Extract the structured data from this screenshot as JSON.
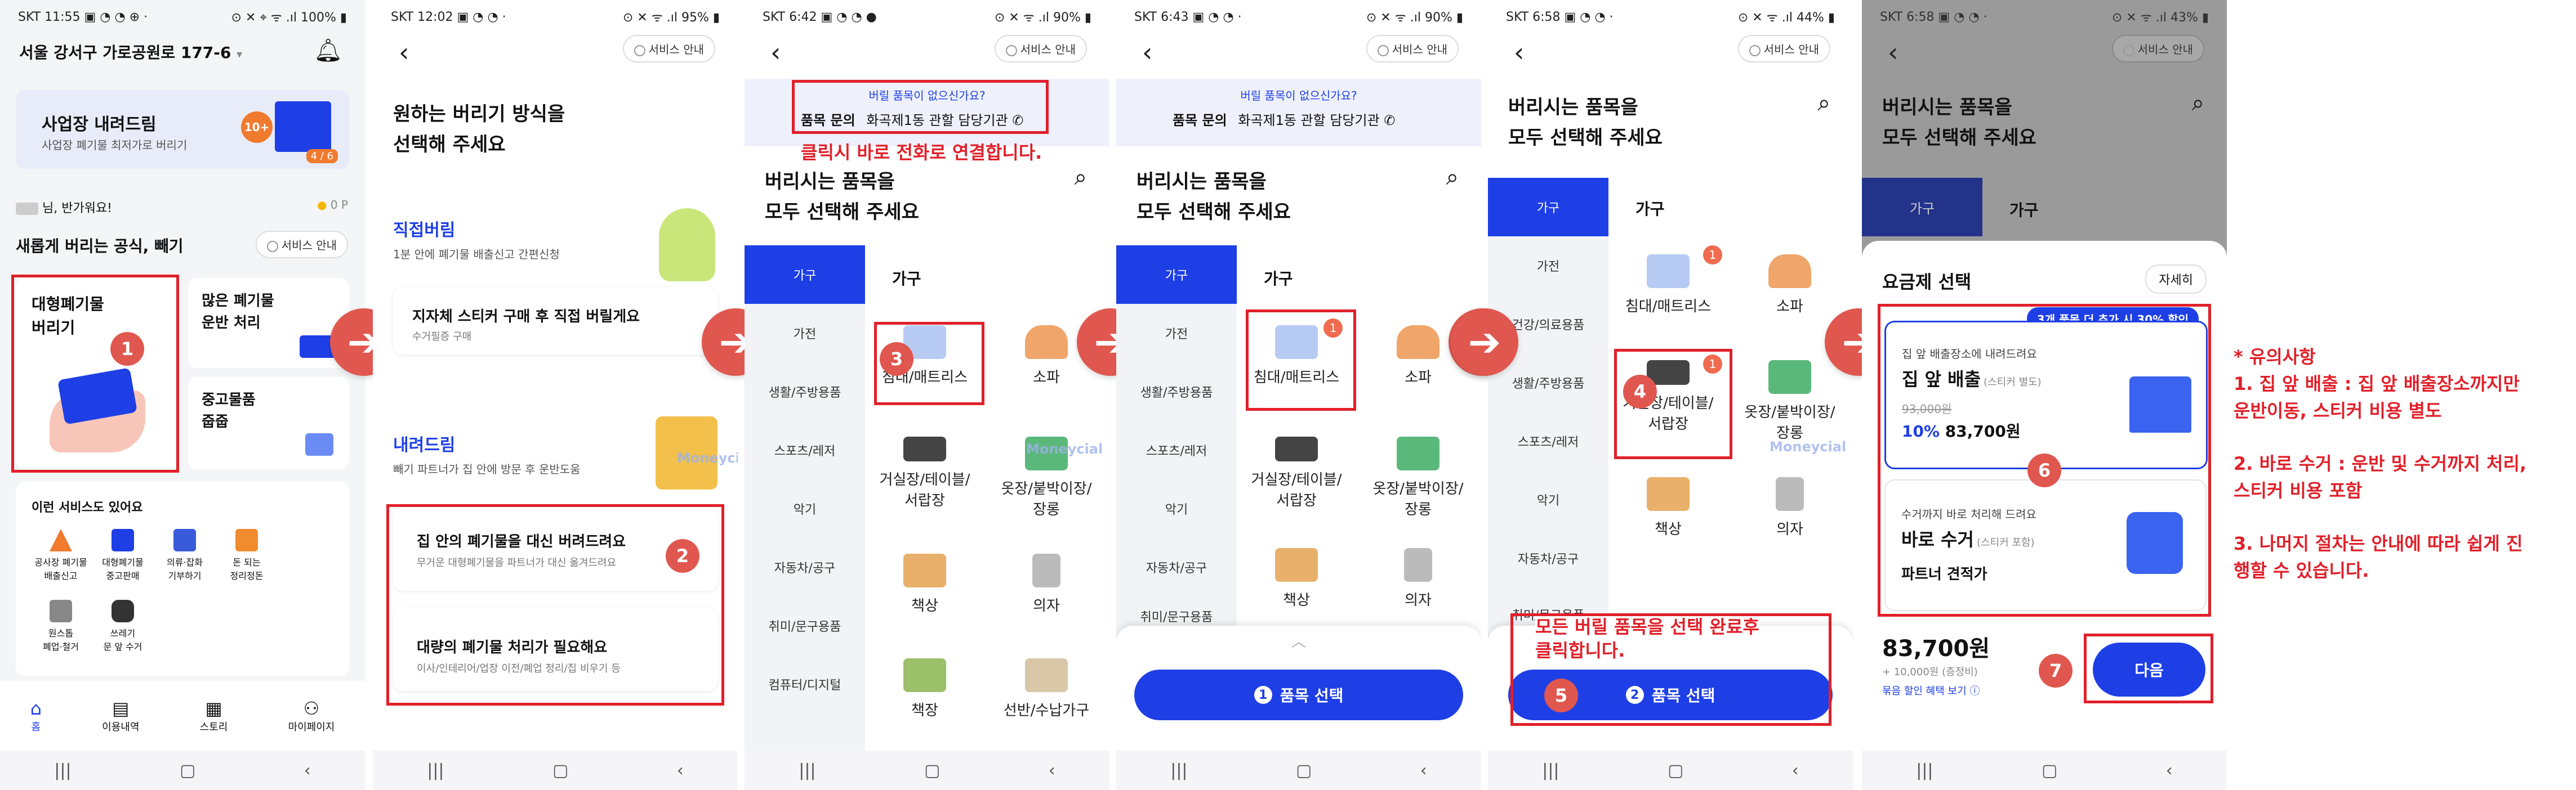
{
  "colors": {
    "accent": "#1e3fe6",
    "highlight": "#e0202a",
    "badge": "#e0574f"
  },
  "arrow_glyph": "➔",
  "watermark": "Moneycial",
  "steps": [
    "1",
    "2",
    "3",
    "4",
    "5",
    "6",
    "7"
  ],
  "screen1": {
    "status_left": "SKT 11:55 ▣ ◔ ◔ ⊕ ·",
    "status_right": "⊙ ✕ ⌖ ᯤ .ıl 100% ▮",
    "address": "서울 강서구 가로공원로 177-6",
    "banner_title": "사업장 내려드림",
    "banner_sub": "사업장 폐기물 최저가로 버리기",
    "banner_tag": "10+",
    "banner_page": "4 / 6",
    "greeting": "님, 반가워요!",
    "points": "0 P",
    "section_title": "새롭게 버리는 공식, 빼기",
    "guide": "서비스 안내",
    "card_big": "대형폐기물\n버리기",
    "card_many": "많은 폐기물\n운반 처리",
    "card_used": "중고물품\n줍줍",
    "services_title": "이런 서비스도 있어요",
    "services": [
      "공사장 폐기물\n배출신고",
      "대형폐기물\n중고판매",
      "의류·잡화\n기부하기",
      "돈 되는\n정리정돈",
      "원스톱\n폐업·철거",
      "쓰레기\n문 앞 수거"
    ],
    "tabs": [
      "홈",
      "이용내역",
      "스토리",
      "마이페이지"
    ]
  },
  "screen2": {
    "status_left": "SKT 12:02 ▣ ◔ ◔ ·",
    "status_right": "⊙ ✕ ᯤ .ıl 95% ▮",
    "guide": "서비스 안내",
    "title": "원하는 버리기 방식을\n선택해 주세요",
    "direct_title": "직접버림",
    "direct_sub": "1분 안에 폐기물 배출신고 간편신청",
    "sticker_title": "지자체 스티커 구매 후 직접 버릴게요",
    "sticker_sub": "수거필증 구매",
    "drop_title": "내려드림",
    "drop_sub": "빼기 파트너가 집 안에 방문 후 운반도움",
    "opt1_title": "집 안의 폐기물을 대신 버려드려요",
    "opt1_sub": "무거운 대형폐기물을 파트너가 대신 옮겨드려요",
    "opt2_title": "대량의 폐기물 처리가 필요해요",
    "opt2_sub": "이사/인테리어/업장 이전/폐업 정리/집 비우기 등"
  },
  "screen3": {
    "status_left": "SKT 6:42 ▣ ◔ ◔ ●",
    "status_right": "⊙ ✕ ᯤ .ıl 90% ▮",
    "guide": "서비스 안내",
    "notice_q": "버릴 품목이 없으신가요?",
    "notice_label": "품목 문의",
    "notice_office": "화곡제1동 관할 담당기관",
    "callout": "클릭시 바로 전화로 연결합니다.",
    "title": "버리시는 품목을\n모두 선택해 주세요",
    "categories": [
      "가구",
      "가전",
      "생활/주방용품",
      "스포츠/레저",
      "악기",
      "자동차/공구",
      "취미/문구용품",
      "컴퓨터/디지털"
    ],
    "section": "가구",
    "items": [
      "침대/매트리스",
      "소파",
      "거실장/테이블/\n서랍장",
      "옷장/붙박이장/\n장롱",
      "책상",
      "의자",
      "책장",
      "선반/수납가구"
    ]
  },
  "screen4": {
    "status_left": "SKT 6:43 ▣ ◔ ◔ ·",
    "status_right": "⊙ ✕ ᯤ .ıl 90% ▮",
    "guide": "서비스 안내",
    "notice_q": "버릴 품목이 없으신가요?",
    "notice_label": "품목 문의",
    "notice_office": "화곡제1동 관할 담당기관",
    "title": "버리시는 품목을\n모두 선택해 주세요",
    "categories": [
      "가구",
      "가전",
      "생활/주방용품",
      "스포츠/레저",
      "악기",
      "자동차/공구",
      "취미/문구용품"
    ],
    "section": "가구",
    "items": [
      "침대/매트리스",
      "소파",
      "거실장/테이블/\n서랍장",
      "옷장/붙박이장/\n장롱",
      "책상",
      "의자"
    ],
    "badge": "1",
    "button": "품목 선택",
    "button_num": "1"
  },
  "screen5": {
    "status_left": "SKT 6:58 ▣ ◔ ◔ ·",
    "status_right": "⊙ ✕ ᯤ .ıl 44% ▮",
    "guide": "서비스 안내",
    "title": "버리시는 품목을\n모두 선택해 주세요",
    "categories": [
      "가구",
      "가전",
      "건강/의료용품",
      "생활/주방용품",
      "스포츠/레저",
      "악기",
      "자동차/공구",
      "취미/문구용품"
    ],
    "section": "가구",
    "items": [
      "침대/매트리스",
      "소파",
      "거실장/테이블/\n서랍장",
      "옷장/붙박이장/\n장롱",
      "책상",
      "의자"
    ],
    "badge": "1",
    "callout": "모든 버릴 품목을 선택 완료후\n클릭합니다.",
    "button": "품목 선택",
    "button_num": "2"
  },
  "screen6": {
    "status_left": "SKT 6:58 ▣ ◔ ◔ ·",
    "status_right": "⊙ ✕ ᯤ .ıl 43% ▮",
    "guide": "서비스 안내",
    "title": "버리시는 품목을\n모두 선택해 주세요",
    "tab_sel": "가구",
    "section": "가구",
    "sheet_title": "요금제 선택",
    "detail_btn": "자세히",
    "promo": "3개 품목 더 추가 시 30% 할인",
    "plan1_sub": "집 앞 배출장소에 내려드려요",
    "plan1_title": "집 앞 배출",
    "plan1_note": "(스티커 별도)",
    "plan1_old": "93,000원",
    "plan1_pct": "10%",
    "plan1_price": "83,700원",
    "plan2_sub": "수거까지 바로 처리해 드려요",
    "plan2_title": "바로 수거",
    "plan2_note": "(스티커 포함)",
    "plan2_quote": "파트너 견적가",
    "total": "83,700원",
    "total_sub": "+ 10,000원 (층정비)",
    "total_link": "묶음 할인 혜택 보기 ⓘ",
    "next": "다음"
  },
  "notes": {
    "heading": "* 유의사항",
    "line1a": "1. 집 앞 배출 : 집 앞 배출장소까지만",
    "line1b": "운반이동, 스티커 비용 별도",
    "line2a": "2. 바로 수거 : 운반 및 수거까지 처리,",
    "line2b": "스티커 비용 포함",
    "line3a": "3. 나머지 절차는 안내에 따라 쉽게 진",
    "line3b": "행할 수 있습니다."
  },
  "nav": [
    "|||",
    "▢",
    "‹"
  ]
}
